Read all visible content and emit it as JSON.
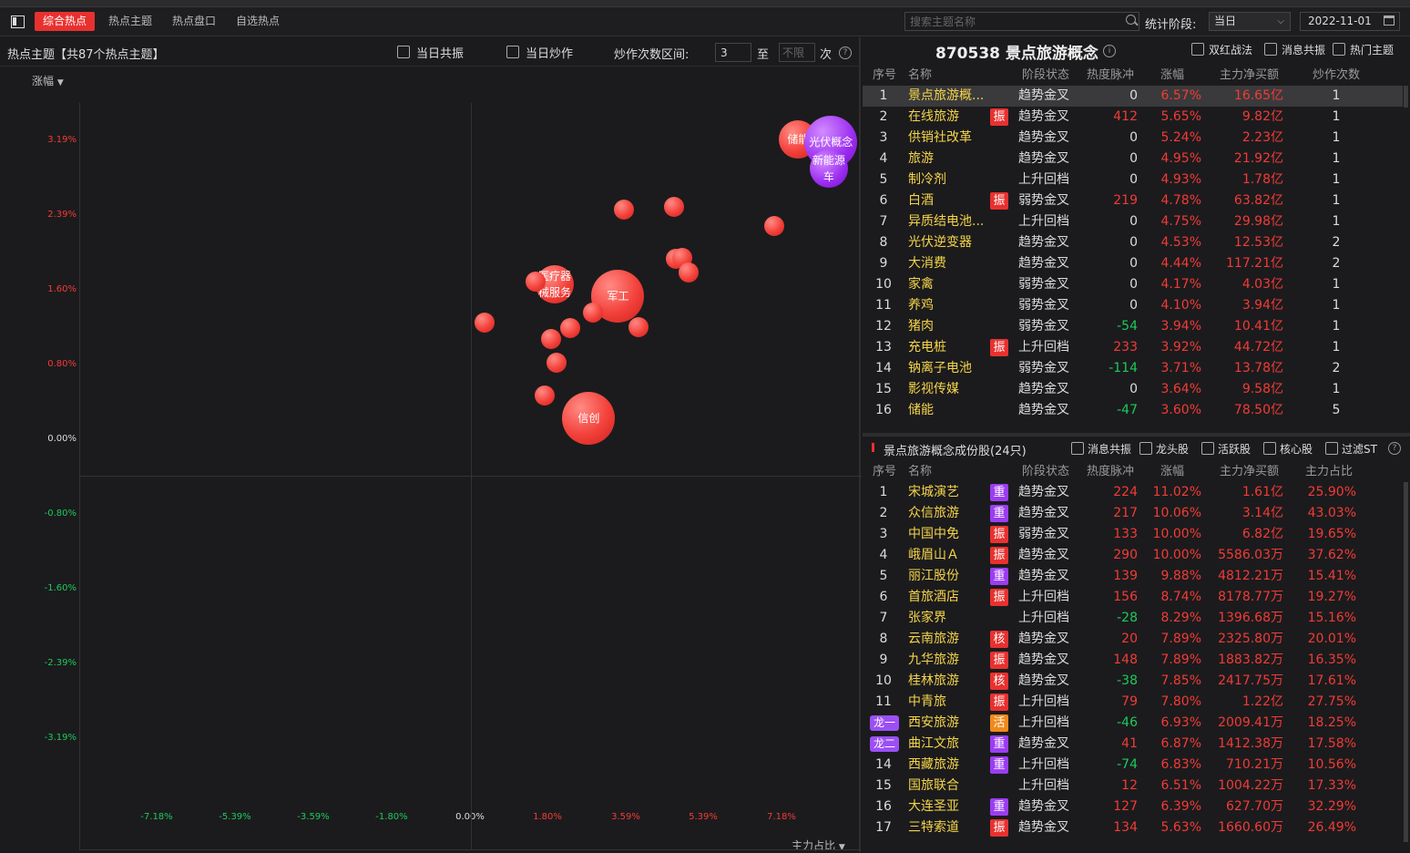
{
  "tabs": [
    "综合热点",
    "热点主题",
    "热点盘口",
    "自选热点"
  ],
  "search_placeholder": "搜索主题名称",
  "stat_label": "统计阶段:",
  "stat_value": "当日",
  "date": "2022-11-01",
  "left": {
    "title": "热点主题【共87个热点主题】",
    "chk1": "当日共振",
    "chk2": "当日炒作",
    "range_label": "炒作次数区间:",
    "range_from": "3",
    "range_to_label": "至",
    "range_to_placeholder": "不限",
    "unit": "次",
    "y_axis": "涨幅",
    "x_axis": "主力占比"
  },
  "chart_data": {
    "type": "scatter",
    "ylabel": "涨幅",
    "xlabel": "主力占比",
    "yticks": [
      "3.19%",
      "2.39%",
      "1.60%",
      "0.80%",
      "0.00%",
      "-0.80%",
      "-1.60%",
      "-2.39%",
      "-3.19%"
    ],
    "xticks": [
      "-7.18%",
      "-5.39%",
      "-3.59%",
      "-1.80%",
      "0.00%",
      "1.80%",
      "3.59%",
      "5.39%",
      "7.18%"
    ],
    "points": [
      {
        "label": "储能",
        "x": 7.5,
        "y": 3.6,
        "r": "md"
      },
      {
        "label": "光伏概念",
        "x": 8.25,
        "y": 3.57,
        "r": "lg",
        "c": "purple"
      },
      {
        "label": "新能源\n车",
        "x": 8.2,
        "y": 3.29,
        "r": "md",
        "c": "purple"
      },
      {
        "label": "",
        "x": 3.5,
        "y": 2.85,
        "r": "sm"
      },
      {
        "label": "",
        "x": 4.66,
        "y": 2.88,
        "r": "sm"
      },
      {
        "label": "",
        "x": 6.95,
        "y": 2.67,
        "r": "sm"
      },
      {
        "label": "",
        "x": 4.7,
        "y": 2.32,
        "r": "sm"
      },
      {
        "label": "",
        "x": 4.85,
        "y": 2.33,
        "r": "sm"
      },
      {
        "label": "",
        "x": 4.98,
        "y": 2.18,
        "r": "sm"
      },
      {
        "label": "医疗器\n械服务",
        "x": 1.92,
        "y": 2.05,
        "r": "md"
      },
      {
        "label": "",
        "x": 1.48,
        "y": 2.08,
        "r": "sm"
      },
      {
        "label": "军工",
        "x": 3.37,
        "y": 1.92,
        "r": "lg"
      },
      {
        "label": "",
        "x": 2.8,
        "y": 1.75,
        "r": "sm"
      },
      {
        "label": "",
        "x": 0.32,
        "y": 1.64,
        "r": "sm"
      },
      {
        "label": "",
        "x": 2.27,
        "y": 1.58,
        "r": "sm"
      },
      {
        "label": "",
        "x": 3.85,
        "y": 1.59,
        "r": "sm"
      },
      {
        "label": "",
        "x": 1.84,
        "y": 1.46,
        "r": "sm"
      },
      {
        "label": "",
        "x": 1.97,
        "y": 1.21,
        "r": "sm"
      },
      {
        "label": "",
        "x": 1.7,
        "y": 0.86,
        "r": "sm"
      },
      {
        "label": "信创",
        "x": 2.7,
        "y": 0.61,
        "r": "lg"
      }
    ]
  },
  "right": {
    "code_title": "870538 景点旅游概念",
    "chk": [
      "双红战法",
      "消息共振",
      "热门主题"
    ],
    "cols1": [
      "序号",
      "名称",
      "阶段状态",
      "热度脉冲",
      "涨幅",
      "主力净买额",
      "炒作次数"
    ],
    "topics": [
      {
        "i": "1",
        "n": "景点旅游概...",
        "t": "",
        "s": "趋势金叉",
        "h": "0",
        "c": "6.57%",
        "f": "16.65亿",
        "k": "1"
      },
      {
        "i": "2",
        "n": "在线旅游",
        "t": "振",
        "s": "趋势金叉",
        "h": "412",
        "c": "5.65%",
        "f": "9.82亿",
        "k": "1"
      },
      {
        "i": "3",
        "n": "供销社改革",
        "t": "",
        "s": "趋势金叉",
        "h": "0",
        "c": "5.24%",
        "f": "2.23亿",
        "k": "1"
      },
      {
        "i": "4",
        "n": "旅游",
        "t": "",
        "s": "趋势金叉",
        "h": "0",
        "c": "4.95%",
        "f": "21.92亿",
        "k": "1"
      },
      {
        "i": "5",
        "n": "制冷剂",
        "t": "",
        "s": "上升回档",
        "h": "0",
        "c": "4.93%",
        "f": "1.78亿",
        "k": "1"
      },
      {
        "i": "6",
        "n": "白酒",
        "t": "振",
        "s": "弱势金叉",
        "h": "219",
        "c": "4.78%",
        "f": "63.82亿",
        "k": "1"
      },
      {
        "i": "7",
        "n": "异质结电池...",
        "t": "",
        "s": "上升回档",
        "h": "0",
        "c": "4.75%",
        "f": "29.98亿",
        "k": "1"
      },
      {
        "i": "8",
        "n": "光伏逆变器",
        "t": "",
        "s": "趋势金叉",
        "h": "0",
        "c": "4.53%",
        "f": "12.53亿",
        "k": "2"
      },
      {
        "i": "9",
        "n": "大消费",
        "t": "",
        "s": "趋势金叉",
        "h": "0",
        "c": "4.44%",
        "f": "117.21亿",
        "k": "2"
      },
      {
        "i": "10",
        "n": "家禽",
        "t": "",
        "s": "弱势金叉",
        "h": "0",
        "c": "4.17%",
        "f": "4.03亿",
        "k": "1"
      },
      {
        "i": "11",
        "n": "养鸡",
        "t": "",
        "s": "弱势金叉",
        "h": "0",
        "c": "4.10%",
        "f": "3.94亿",
        "k": "1"
      },
      {
        "i": "12",
        "n": "猪肉",
        "t": "",
        "s": "弱势金叉",
        "h": "-54",
        "c": "3.94%",
        "f": "10.41亿",
        "k": "1"
      },
      {
        "i": "13",
        "n": "充电桩",
        "t": "振",
        "s": "上升回档",
        "h": "233",
        "c": "3.92%",
        "f": "44.72亿",
        "k": "1"
      },
      {
        "i": "14",
        "n": "钠离子电池",
        "t": "",
        "s": "弱势金叉",
        "h": "-114",
        "c": "3.71%",
        "f": "13.78亿",
        "k": "2"
      },
      {
        "i": "15",
        "n": "影视传媒",
        "t": "",
        "s": "趋势金叉",
        "h": "0",
        "c": "3.64%",
        "f": "9.58亿",
        "k": "1"
      },
      {
        "i": "16",
        "n": "储能",
        "t": "",
        "s": "趋势金叉",
        "h": "-47",
        "c": "3.60%",
        "f": "78.50亿",
        "k": "5"
      }
    ],
    "stocks_title": "景点旅游概念成份股(24只)",
    "chk2": [
      "消息共振",
      "龙头股",
      "活跃股",
      "核心股",
      "过滤ST"
    ],
    "cols2": [
      "序号",
      "名称",
      "阶段状态",
      "热度脉冲",
      "涨幅",
      "主力净买额",
      "主力占比"
    ],
    "stocks": [
      {
        "i": "1",
        "n": "宋城演艺",
        "t": "重",
        "s": "趋势金叉",
        "h": "224",
        "c": "11.02%",
        "f": "1.61亿",
        "r": "25.90%"
      },
      {
        "i": "2",
        "n": "众信旅游",
        "t": "重",
        "s": "趋势金叉",
        "h": "217",
        "c": "10.06%",
        "f": "3.14亿",
        "r": "43.03%"
      },
      {
        "i": "3",
        "n": "中国中免",
        "t": "振",
        "s": "弱势金叉",
        "h": "133",
        "c": "10.00%",
        "f": "6.82亿",
        "r": "19.65%"
      },
      {
        "i": "4",
        "n": "峨眉山Ａ",
        "t": "振",
        "s": "趋势金叉",
        "h": "290",
        "c": "10.00%",
        "f": "5586.03万",
        "r": "37.62%"
      },
      {
        "i": "5",
        "n": "丽江股份",
        "t": "重",
        "s": "趋势金叉",
        "h": "139",
        "c": "9.88%",
        "f": "4812.21万",
        "r": "15.41%"
      },
      {
        "i": "6",
        "n": "首旅酒店",
        "t": "振",
        "s": "上升回档",
        "h": "156",
        "c": "8.74%",
        "f": "8178.77万",
        "r": "19.27%"
      },
      {
        "i": "7",
        "n": "张家界",
        "t": "",
        "s": "上升回档",
        "h": "-28",
        "c": "8.29%",
        "f": "1396.68万",
        "r": "15.16%"
      },
      {
        "i": "8",
        "n": "云南旅游",
        "t": "核",
        "s": "趋势金叉",
        "h": "20",
        "c": "7.89%",
        "f": "2325.80万",
        "r": "20.01%"
      },
      {
        "i": "9",
        "n": "九华旅游",
        "t": "振",
        "s": "趋势金叉",
        "h": "148",
        "c": "7.89%",
        "f": "1883.82万",
        "r": "16.35%"
      },
      {
        "i": "10",
        "n": "桂林旅游",
        "t": "核",
        "s": "趋势金叉",
        "h": "-38",
        "c": "7.85%",
        "f": "2417.75万",
        "r": "17.61%"
      },
      {
        "i": "11",
        "n": "中青旅",
        "t": "振",
        "s": "上升回档",
        "h": "79",
        "c": "7.80%",
        "f": "1.22亿",
        "r": "27.75%"
      },
      {
        "i": "龙一",
        "n": "西安旅游",
        "t": "活",
        "s": "上升回档",
        "h": "-46",
        "c": "6.93%",
        "f": "2009.41万",
        "r": "18.25%"
      },
      {
        "i": "龙二",
        "n": "曲江文旅",
        "t": "重",
        "s": "趋势金叉",
        "h": "41",
        "c": "6.87%",
        "f": "1412.38万",
        "r": "17.58%"
      },
      {
        "i": "14",
        "n": "西藏旅游",
        "t": "重",
        "s": "上升回档",
        "h": "-74",
        "c": "6.83%",
        "f": "710.21万",
        "r": "10.56%"
      },
      {
        "i": "15",
        "n": "国旅联合",
        "t": "",
        "s": "上升回档",
        "h": "12",
        "c": "6.51%",
        "f": "1004.22万",
        "r": "17.33%"
      },
      {
        "i": "16",
        "n": "大连圣亚",
        "t": "重",
        "s": "趋势金叉",
        "h": "127",
        "c": "6.39%",
        "f": "627.70万",
        "r": "32.29%"
      },
      {
        "i": "17",
        "n": "三特索道",
        "t": "振",
        "s": "趋势金叉",
        "h": "134",
        "c": "5.63%",
        "f": "1660.60万",
        "r": "26.49%"
      }
    ]
  }
}
